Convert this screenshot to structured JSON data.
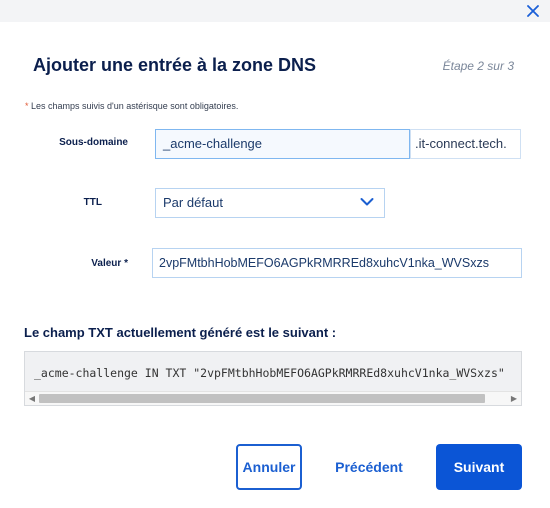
{
  "dialog": {
    "title": "Ajouter une entrée à la zone DNS",
    "step": "Étape 2 sur 3",
    "required_star": "*",
    "required_note": " Les champs suivis d'un astérisque sont obligatoires."
  },
  "form": {
    "subdomain": {
      "label": "Sous-domaine",
      "value": "_acme-challenge",
      "suffix": ".it-connect.tech."
    },
    "ttl": {
      "label": "TTL",
      "selected": "Par défaut"
    },
    "value": {
      "label": "Valeur",
      "required_mark": "*",
      "value": "2vpFMtbhHobMEFO6AGPkRMRREd8xuhcV1nka_WVSxzs"
    }
  },
  "txt_preview": {
    "heading": "Le champ TXT actuellement généré est le suivant :",
    "code": "_acme-challenge IN TXT \"2vpFMtbhHobMEFO6AGPkRMRREd8xuhcV1nka_WVSxzs\""
  },
  "buttons": {
    "cancel": "Annuler",
    "previous": "Précédent",
    "next": "Suivant"
  },
  "icons": {
    "close": "close-icon",
    "select": "chevron-down-icon",
    "scroll_left": "arrow-left-icon",
    "scroll_right": "arrow-right-icon"
  },
  "colors": {
    "primary": "#0b55d6",
    "text_dark": "#0b1f4d",
    "required": "#e05a36"
  }
}
